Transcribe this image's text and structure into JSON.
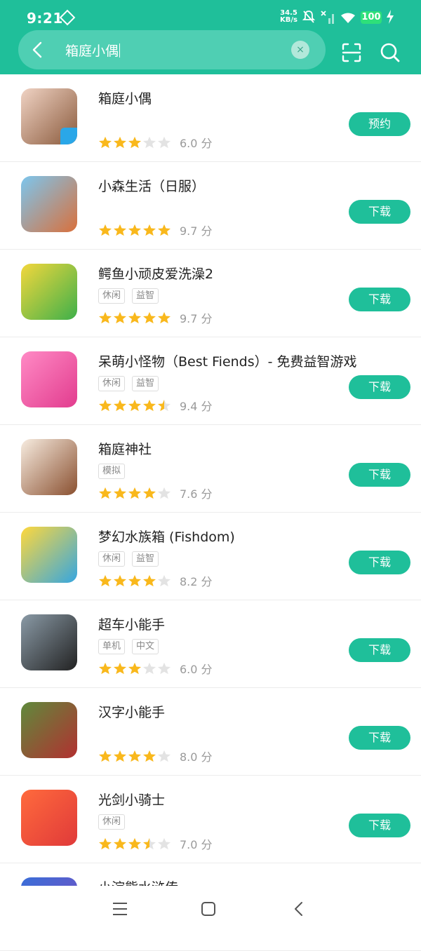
{
  "status": {
    "time": "9:21",
    "net_speed": "34.5",
    "net_unit": "KB/s",
    "battery": "100"
  },
  "search": {
    "query": "箱庭小偶",
    "clear": "×"
  },
  "apps": [
    {
      "name": "箱庭小偶",
      "tags": [],
      "stars": 3,
      "score": "6.0 分",
      "button": "预约",
      "badge": true,
      "grad": [
        "#f0d3c4",
        "#8a5a3c"
      ]
    },
    {
      "name": "小森生活（日服）",
      "tags": [],
      "stars": 5,
      "score": "9.7 分",
      "button": "下载",
      "badge": false,
      "grad": [
        "#7cc6ee",
        "#d9703c"
      ]
    },
    {
      "name": "鳄鱼小顽皮爱洗澡2",
      "tags": [
        "休闲",
        "益智"
      ],
      "stars": 5,
      "score": "9.7 分",
      "button": "下载",
      "badge": false,
      "grad": [
        "#f3d73c",
        "#3eb04a"
      ]
    },
    {
      "name": "呆萌小怪物（Best Fiends）- 免费益智游戏",
      "tags": [
        "休闲",
        "益智"
      ],
      "stars": 4.5,
      "score": "9.4 分",
      "button": "下载",
      "badge": false,
      "grad": [
        "#ff8ac5",
        "#e23c8e"
      ]
    },
    {
      "name": "箱庭神社",
      "tags": [
        "模拟"
      ],
      "stars": 4,
      "score": "7.6 分",
      "button": "下载",
      "badge": false,
      "grad": [
        "#f7ece0",
        "#8a5030"
      ]
    },
    {
      "name": "梦幻水族箱 (Fishdom)",
      "tags": [
        "休闲",
        "益智"
      ],
      "stars": 4,
      "score": "8.2 分",
      "button": "下载",
      "badge": false,
      "grad": [
        "#ffd83c",
        "#35a6e0"
      ]
    },
    {
      "name": "超车小能手",
      "tags": [
        "单机",
        "中文"
      ],
      "stars": 3,
      "score": "6.0 分",
      "button": "下载",
      "badge": false,
      "grad": [
        "#8a9aa6",
        "#222"
      ]
    },
    {
      "name": "汉字小能手",
      "tags": [],
      "stars": 4,
      "score": "8.0 分",
      "button": "下载",
      "badge": false,
      "grad": [
        "#5f8a3c",
        "#b23030"
      ]
    },
    {
      "name": "光剑小骑士",
      "tags": [
        "休闲"
      ],
      "stars": 3.5,
      "score": "7.0 分",
      "button": "下载",
      "badge": false,
      "grad": [
        "#ff6a3c",
        "#e03a3a"
      ]
    },
    {
      "name": "小浣熊水浒传",
      "tags": [],
      "stars": 0,
      "score": "",
      "button": "",
      "badge": false,
      "grad": [
        "#3a6ed8",
        "#7a4ec0"
      ]
    }
  ],
  "colors": {
    "accent": "#1fbf9a",
    "star": "#f9b81c",
    "star_empty": "#e3e3e3"
  },
  "icons": [
    "back-icon",
    "scan-icon",
    "search-icon",
    "clear-icon",
    "menu-icon",
    "home-icon",
    "nav-back-icon"
  ]
}
